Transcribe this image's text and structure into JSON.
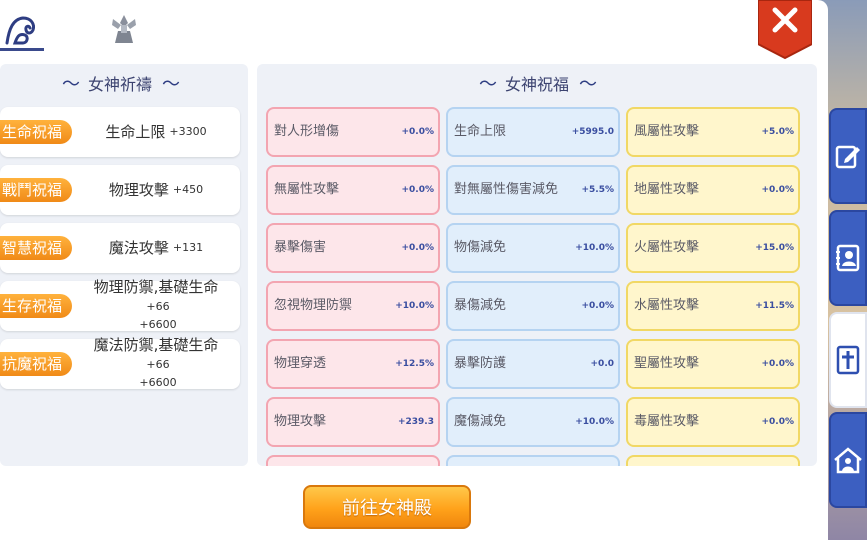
{
  "tabs": [
    {
      "icon": "goddess-silhouette-icon"
    },
    {
      "icon": "crystal-emblem-icon"
    }
  ],
  "close_icon": "close-icon",
  "left_section": {
    "title": "女神祈禱",
    "blessings": [
      {
        "tag": "生命祝福",
        "text": "生命上限",
        "bonus": "+3300"
      },
      {
        "tag": "戰鬥祝福",
        "text": "物理攻擊",
        "bonus": "+450"
      },
      {
        "tag": "智慧祝福",
        "text": "魔法攻擊",
        "bonus": "+131"
      },
      {
        "tag": "生存祝福",
        "text": "物理防禦,基礎生命",
        "bonus": "+66",
        "bonus2": "+6600"
      },
      {
        "tag": "抗魔祝福",
        "text": "魔法防禦,基礎生命",
        "bonus": "+66",
        "bonus2": "+6600"
      }
    ]
  },
  "right_section": {
    "title": "女神祝福",
    "columns": [
      [
        {
          "label": "對人形增傷",
          "value": "+0.0%"
        },
        {
          "label": "無屬性攻擊",
          "value": "+0.0%"
        },
        {
          "label": "暴擊傷害",
          "value": "+0.0%"
        },
        {
          "label": "忽視物理防禦",
          "value": "+10.0%"
        },
        {
          "label": "物理穿透",
          "value": "+12.5%"
        },
        {
          "label": "物理攻擊",
          "value": "+239.3"
        }
      ],
      [
        {
          "label": "生命上限",
          "value": "+5995.0"
        },
        {
          "label": "對無屬性傷害減免",
          "value": "+5.5%"
        },
        {
          "label": "物傷減免",
          "value": "+10.0%"
        },
        {
          "label": "暴傷減免",
          "value": "+0.0%"
        },
        {
          "label": "暴擊防護",
          "value": "+0.0"
        },
        {
          "label": "魔傷減免",
          "value": "+10.0%"
        }
      ],
      [
        {
          "label": "風屬性攻擊",
          "value": "+5.0%"
        },
        {
          "label": "地屬性攻擊",
          "value": "+0.0%"
        },
        {
          "label": "火屬性攻擊",
          "value": "+15.0%"
        },
        {
          "label": "水屬性攻擊",
          "value": "+11.5%"
        },
        {
          "label": "聖屬性攻擊",
          "value": "+0.0%"
        },
        {
          "label": "毒屬性攻擊",
          "value": "+0.0%"
        }
      ]
    ]
  },
  "go_button": "前往女神殿",
  "side_tabs": [
    {
      "icon": "edit-icon",
      "active": false
    },
    {
      "icon": "contact-card-icon",
      "active": false
    },
    {
      "icon": "cross-icon",
      "active": true
    },
    {
      "icon": "home-people-icon",
      "active": false
    }
  ],
  "colors": {
    "accent_orange": "#f08a17",
    "tab_blue": "#3c5fc1",
    "value_blue": "#3a4ea0"
  }
}
